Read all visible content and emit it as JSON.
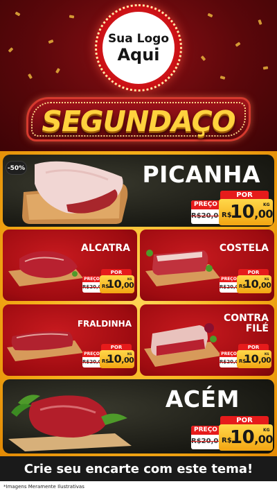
{
  "logo": {
    "line1": "Sua Logo",
    "line2": "Aqui"
  },
  "banner": {
    "title": "SEGUNDAÇO"
  },
  "colors": {
    "header_red": "#5a070a",
    "card_red": "#9d0b10",
    "gold": "#f6b21b",
    "price_yellow": "#ffd84a",
    "label_red": "#e61b1b",
    "dark": "#1a1a1a"
  },
  "tag_labels": {
    "por": "POR",
    "preco": "PREÇO",
    "currency": "R$",
    "unit": "KG"
  },
  "products": {
    "picanha": {
      "name": "PICANHA",
      "discount": "-50%",
      "old_price": "R$20,00",
      "price_int": "10",
      "price_dec": ",00",
      "image": "picanha-cut"
    },
    "alcatra": {
      "name": "ALCATRA",
      "old_price": "R$20,00",
      "price_int": "10",
      "price_dec": ",00",
      "image": "alcatra-cut"
    },
    "costela": {
      "name": "COSTELA",
      "old_price": "R$20,00",
      "price_int": "10",
      "price_dec": ",00",
      "image": "costela-cut"
    },
    "fraldinha": {
      "name": "FRALDINHA",
      "old_price": "R$20,00",
      "price_int": "10",
      "price_dec": ",00",
      "image": "fraldinha-cut"
    },
    "contra_file": {
      "name_line1": "CONTRA",
      "name_line2": "FILÉ",
      "old_price": "R$20,00",
      "price_int": "10",
      "price_dec": ",00",
      "image": "contra-file-cut"
    },
    "acem": {
      "name": "ACÉM",
      "old_price": "R$20,00",
      "price_int": "10",
      "price_dec": ",00",
      "image": "acem-cut"
    }
  },
  "footer": {
    "cta": "Crie seu encarte com este tema!",
    "disclaimer": "*Imagens Meramente Ilustrativas"
  }
}
